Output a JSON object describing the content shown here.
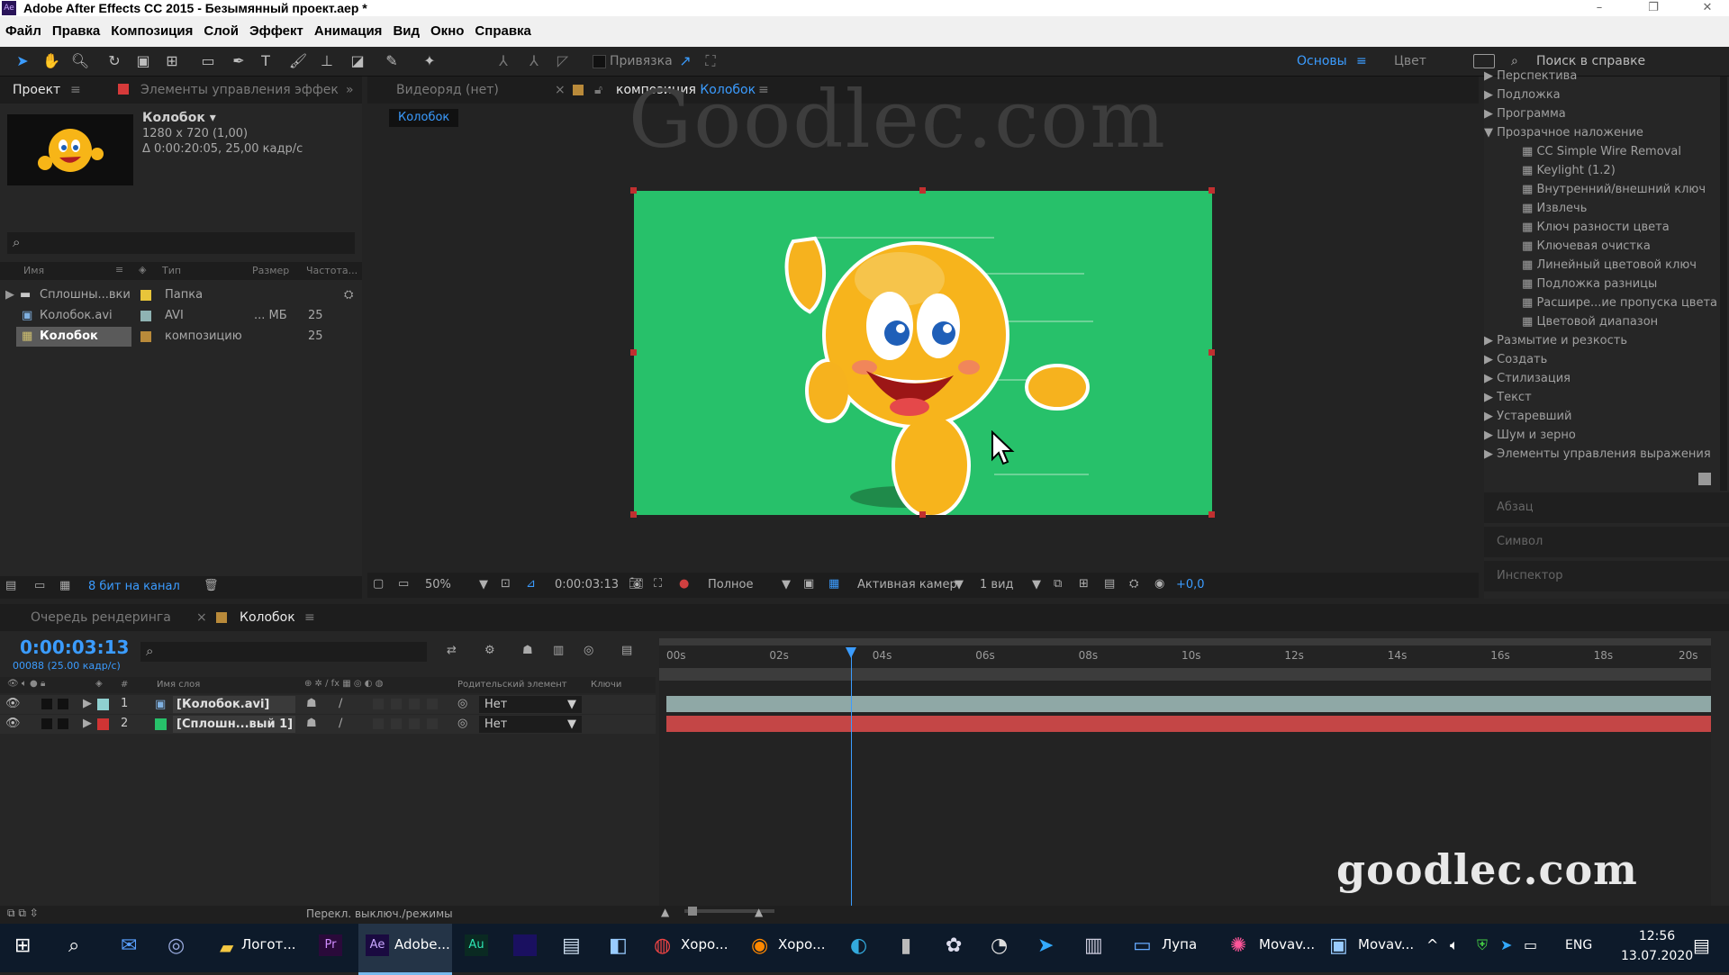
{
  "window": {
    "title": "Adobe After Effects CC 2015 - Безымянный проект.aep *",
    "app_badge": "Ae"
  },
  "menu": [
    "Файл",
    "Правка",
    "Композиция",
    "Слой",
    "Эффект",
    "Анимация",
    "Вид",
    "Окно",
    "Справка"
  ],
  "toolbar": {
    "snap_label": "Привязка",
    "workspace_main": "Основы",
    "workspace_color": "Цвет",
    "help_placeholder": "Поиск в справке"
  },
  "project_panel": {
    "tab_project": "Проект",
    "tab_effects": "Элементы управления эффек",
    "comp_name": "Колобок",
    "comp_size": "1280 x 720 (1,00)",
    "comp_duration": "Δ 0:00:20:05, 25,00 кадр/с",
    "columns": {
      "name": "Имя",
      "type": "Тип",
      "size": "Размер",
      "rate": "Частота..."
    },
    "items": [
      {
        "name": "Сплошны...вки",
        "type": "Папка",
        "size": "",
        "rate": "",
        "color": "#e8c53a"
      },
      {
        "name": "Колобок.avi",
        "type": "AVI",
        "size": "... МБ",
        "rate": "25",
        "color": "#8fb3b3"
      },
      {
        "name": "Колобок",
        "type": "композицию",
        "size": "",
        "rate": "25",
        "color": "#b98a3a"
      }
    ],
    "bit_depth": "8 бит на канал"
  },
  "viewer": {
    "tab_footage": "Видеоряд (нет)",
    "tab_comp_prefix": "композиция",
    "tab_comp_name": "Колобок",
    "breadcrumb": "Колобок",
    "comp_bg_color": "#27c16a",
    "zoom": "50%",
    "timecode": "0:00:03:13",
    "resolution": "Полное",
    "camera": "Активная камер",
    "views": "1 вид",
    "exposure": "+0,0"
  },
  "watermark_top": "Goodlec.com",
  "watermark_bottom": "goodlec.com",
  "effects_panel": {
    "items": [
      {
        "label": "Перспектива",
        "kind": "cat"
      },
      {
        "label": "Подложка",
        "kind": "cat"
      },
      {
        "label": "Программа",
        "kind": "cat"
      },
      {
        "label": "Прозрачное наложение",
        "kind": "open"
      },
      {
        "label": "CC Simple Wire Removal",
        "kind": "fx"
      },
      {
        "label": "Keylight (1.2)",
        "kind": "fx"
      },
      {
        "label": "Внутренний/внешний ключ",
        "kind": "fx"
      },
      {
        "label": "Извлечь",
        "kind": "fx"
      },
      {
        "label": "Ключ разности цвета",
        "kind": "fx"
      },
      {
        "label": "Ключевая очистка",
        "kind": "fx"
      },
      {
        "label": "Линейный цветовой ключ",
        "kind": "fx"
      },
      {
        "label": "Подложка разницы",
        "kind": "fx"
      },
      {
        "label": "Расшире...ие пропуска цвета",
        "kind": "fx"
      },
      {
        "label": "Цветовой диапазон",
        "kind": "fx"
      },
      {
        "label": "Размытие и резкость",
        "kind": "cat"
      },
      {
        "label": "Создать",
        "kind": "cat"
      },
      {
        "label": "Стилизация",
        "kind": "cat"
      },
      {
        "label": "Текст",
        "kind": "cat"
      },
      {
        "label": "Устаревший",
        "kind": "cat"
      },
      {
        "label": "Шум и зерно",
        "kind": "cat"
      },
      {
        "label": "Элементы управления выражения",
        "kind": "cat"
      }
    ],
    "paragraph": "Абзац",
    "symbol": "Символ",
    "inspector": "Инспектор"
  },
  "timeline": {
    "tab_render": "Очередь рендеринга",
    "tab_comp": "Колобок",
    "timecode": "0:00:03:13",
    "frame_info": "00088 (25.00 кадр/с)",
    "col_layer_name": "Имя слоя",
    "col_parent": "Родительский элемент",
    "col_keys": "Ключи",
    "ruler": [
      "00s",
      "02s",
      "04s",
      "06s",
      "08s",
      "10s",
      "12s",
      "14s",
      "16s",
      "18s",
      "20s"
    ],
    "playhead_fraction": 0.179,
    "layers": [
      {
        "num": "1",
        "name": "[Колобок.avi]",
        "parent": "Нет",
        "label_color": "#8fd0d0",
        "bar_color": "#8fa8a6"
      },
      {
        "num": "2",
        "name": "[Сплошн...вый 1]",
        "parent": "Нет",
        "label_color": "#d03434",
        "bar_color": "#c44646"
      }
    ],
    "switch_label": "Перекл. выключ./режимы"
  },
  "taskbar": {
    "apps": [
      {
        "label": "Логот...",
        "icon": "folder-icon"
      },
      {
        "label": "Adobe...",
        "icon": "after-effects-icon"
      },
      {
        "label": "Хоро...",
        "icon": "chrome-icon"
      },
      {
        "label": "Хоро...",
        "icon": "firefox-icon"
      },
      {
        "label": "Лупа",
        "icon": "magnifier-icon"
      },
      {
        "label": "Movav...",
        "icon": "movavi-icon"
      },
      {
        "label": "Movav...",
        "icon": "movavi-screen-icon"
      }
    ],
    "lang": "ENG",
    "time": "12:56",
    "date": "13.07.2020"
  }
}
